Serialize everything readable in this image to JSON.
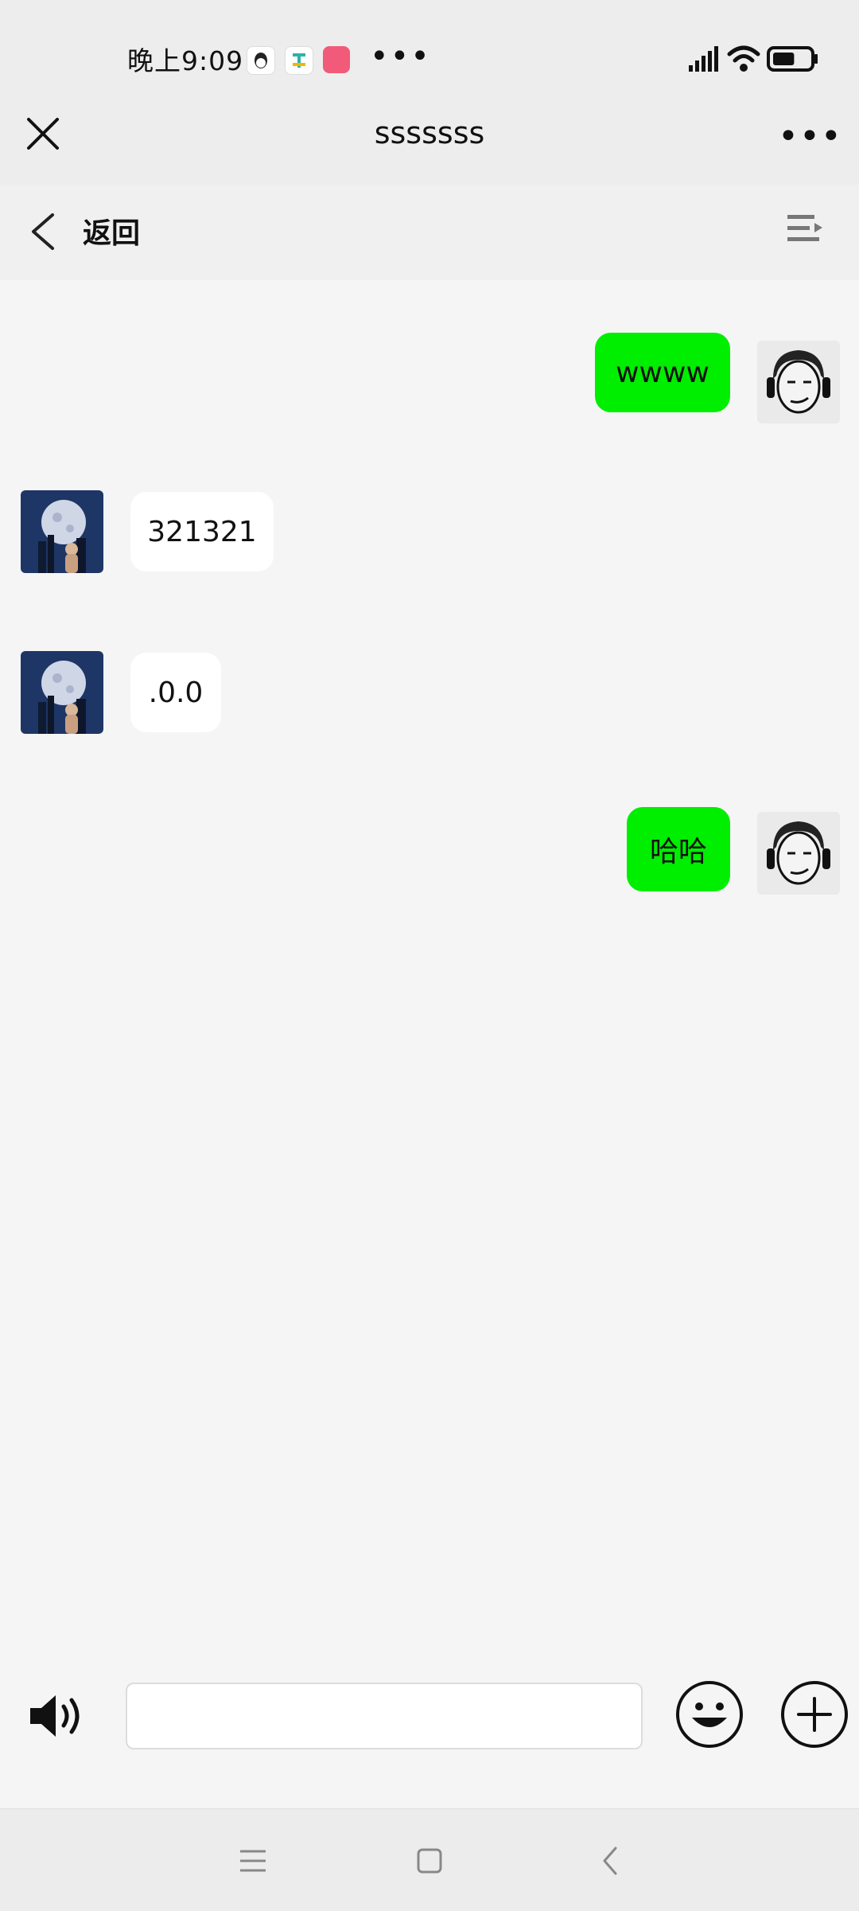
{
  "status_bar": {
    "time": "晚上9:09",
    "overflow": "•••",
    "notifications": [
      "qq-icon",
      "app-icon",
      "red-app-icon"
    ],
    "battery_level": 0.6
  },
  "title_bar": {
    "title": "sssssss",
    "more": "•••"
  },
  "sub_header": {
    "back_label": "返回"
  },
  "messages": [
    {
      "direction": "out",
      "text": "wwww"
    },
    {
      "direction": "in",
      "text": "321321"
    },
    {
      "direction": "in",
      "text": ".0.0"
    },
    {
      "direction": "out",
      "text": "哈哈"
    }
  ],
  "input_bar": {
    "placeholder": ""
  },
  "colors": {
    "outgoing_bubble": "#00ee00",
    "incoming_bubble": "#ffffff",
    "background": "#f5f5f6"
  }
}
